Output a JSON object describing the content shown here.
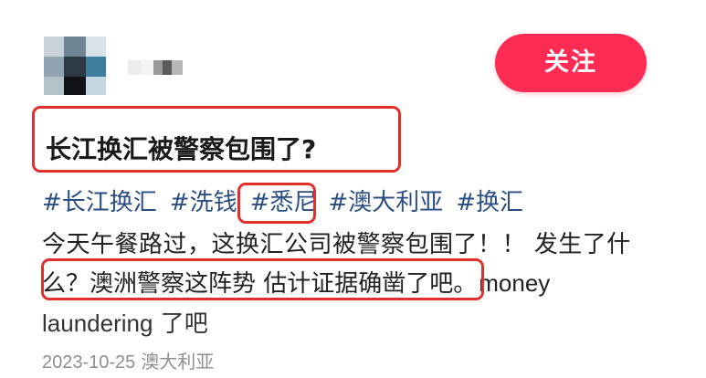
{
  "header": {
    "follow_label": "关注"
  },
  "post": {
    "title": "长江换汇被警察包围了?",
    "hashtags": [
      "#长江换汇",
      "#洗钱",
      "#悉尼",
      "#澳大利亚",
      "#换汇"
    ],
    "body": {
      "line1": "今天午餐路过，这换汇公司被警察包围了！！ 发生了什",
      "line2_cn": "么？澳洲警察这阵势 估计证据确凿了吧。",
      "line2_en": "money",
      "line3_en": "laundering",
      "line3_cn": " 了吧"
    },
    "meta": {
      "date": "2023-10-25",
      "location": "澳大利亚"
    }
  },
  "colors": {
    "follow_button_bg": "#fe2c55",
    "hashtag_color": "#2b4e82",
    "annotation_red": "#e0302e",
    "meta_gray": "#8f8f8f"
  },
  "icons": {
    "avatar": "pixelated-avatar",
    "username": "blurred-username"
  }
}
